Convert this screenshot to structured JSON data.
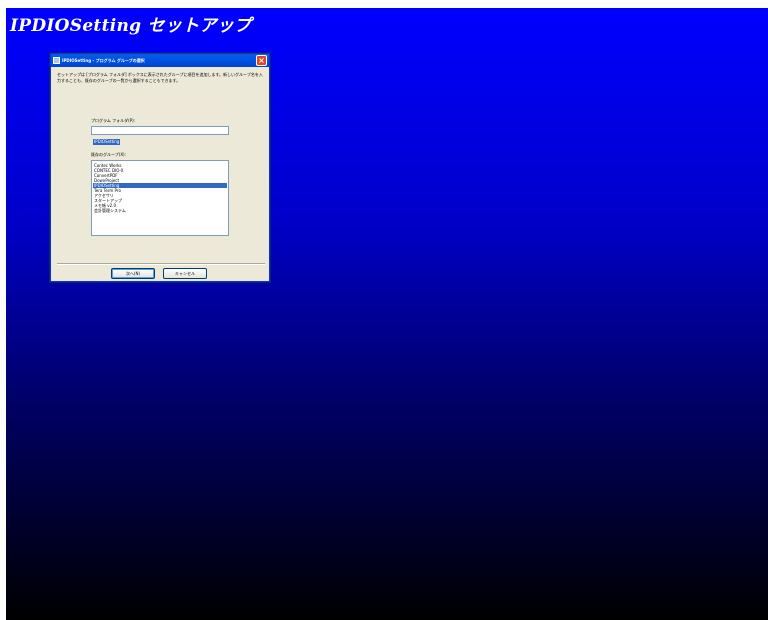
{
  "setup": {
    "title": "IPDIOSetting セットアップ"
  },
  "dialog": {
    "title": "IPDIOSetting - プログラム グループの選択",
    "description": "セットアップは [プログラム フォルダ] ボックスに表示されたグループに項目を追加します。新しいグループ名を入力することも、既存のグループの一覧から選択することもできます。",
    "folder_label": "プログラム フォルダ(P):",
    "folder_value": "IPDIOSetting",
    "existing_label": "既存のグループ(X):",
    "groups": [
      "Contec Works",
      "CONTEC DIO-X",
      "ConvertPDF",
      "DownProject",
      "IPDIOSetting",
      "Tera Term Pro",
      "アクセサリ",
      "スタートアップ",
      "メモ帳 v2.0",
      "会計管理システム"
    ],
    "selected_group": "IPDIOSetting",
    "next_button": "次へ(N)",
    "cancel_button": "キャンセル"
  }
}
